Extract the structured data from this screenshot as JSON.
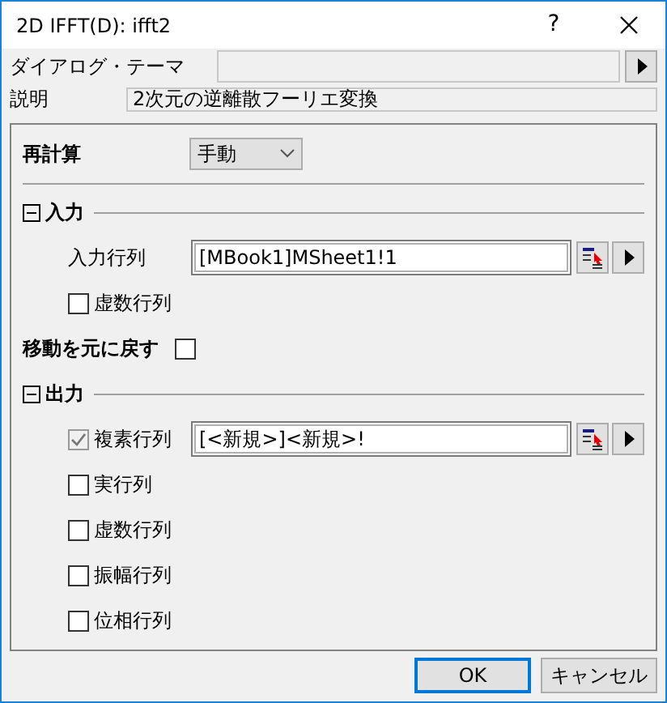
{
  "window": {
    "title": "2D IFFT(D): ifft2",
    "help": "?"
  },
  "theme": {
    "label": "ダイアログ・テーマ"
  },
  "description": {
    "label": "説明",
    "value": "2次元の逆離散フーリエ変換"
  },
  "items": [
    {
      "kind": "dropdown",
      "label": "再計算",
      "value": "手動"
    },
    {
      "kind": "section",
      "label": "入力",
      "expanded": true,
      "children": [
        {
          "kind": "field",
          "label": "入力行列",
          "value": "[MBook1]MSheet1!1"
        },
        {
          "kind": "checkbox",
          "label": "虚数行列",
          "checked": false,
          "disabled": false
        }
      ]
    },
    {
      "kind": "option",
      "label": "移動を元に戻す",
      "checked": false
    },
    {
      "kind": "section",
      "label": "出力",
      "expanded": true,
      "children": [
        {
          "kind": "checkfield",
          "label": "複素行列",
          "checked": true,
          "disabled": true,
          "value": "[<新規>]<新規>!"
        },
        {
          "kind": "checkbox",
          "label": "実行列",
          "checked": false,
          "disabled": false
        },
        {
          "kind": "checkbox",
          "label": "虚数行列",
          "checked": false,
          "disabled": false
        },
        {
          "kind": "checkbox",
          "label": "振幅行列",
          "checked": false,
          "disabled": false
        },
        {
          "kind": "checkbox",
          "label": "位相行列",
          "checked": false,
          "disabled": false
        }
      ]
    }
  ],
  "buttons": [
    {
      "label": "OK",
      "default": true
    },
    {
      "label": "キャンセル",
      "default": false
    }
  ]
}
